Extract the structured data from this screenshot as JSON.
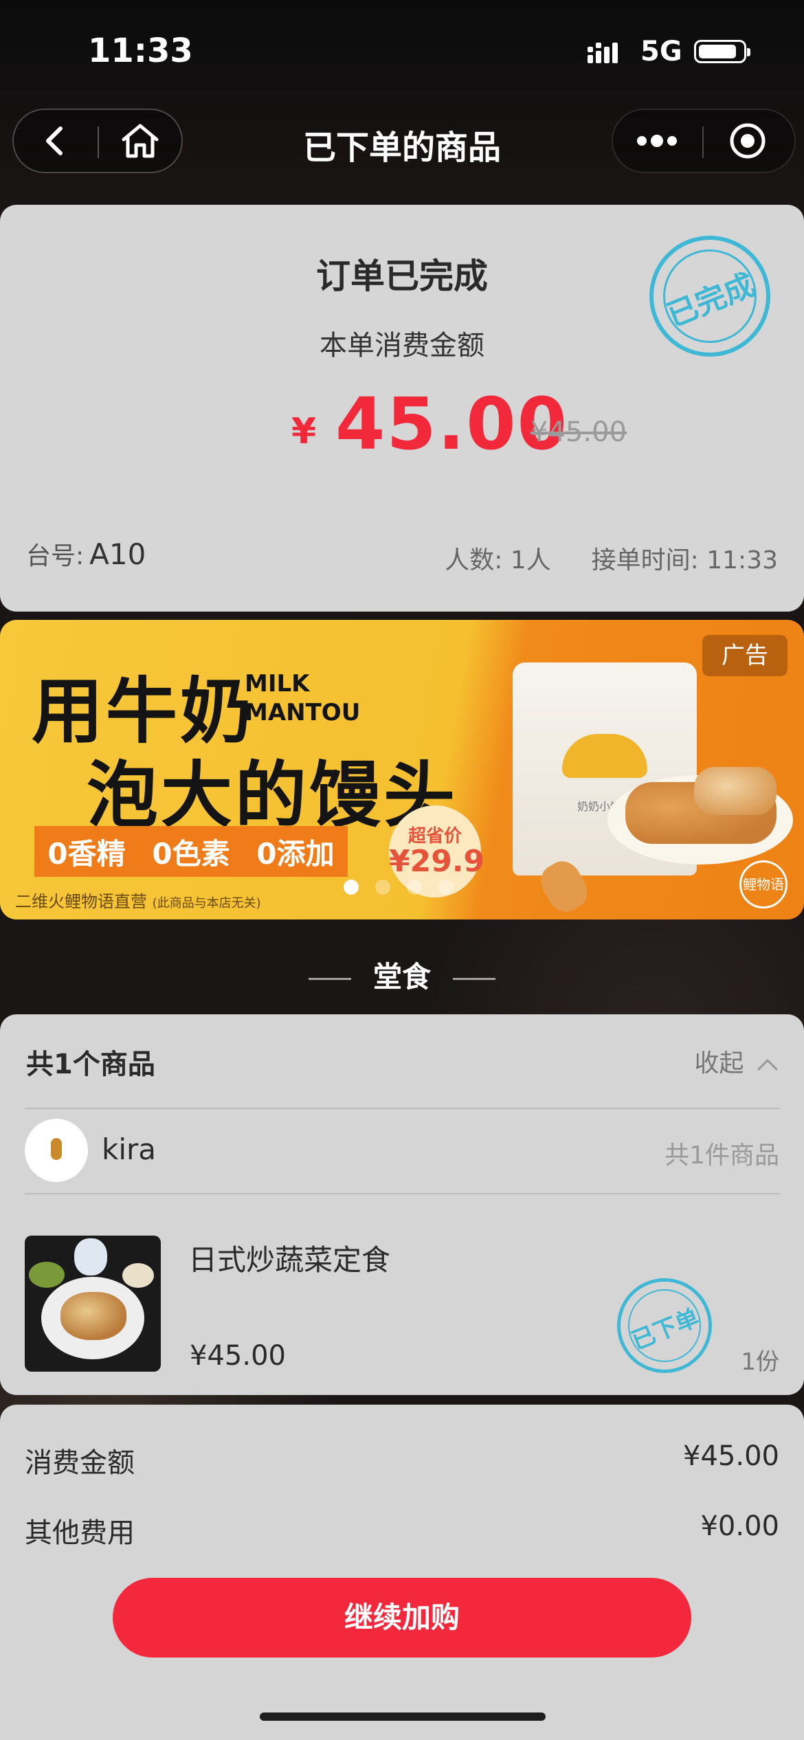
{
  "status_bar": {
    "time": "11:33",
    "network": "5G"
  },
  "nav": {
    "title": "已下单的商品"
  },
  "order": {
    "status_title": "订单已完成",
    "amount_label": "本单消费金额",
    "currency": "¥",
    "amount": "45.00",
    "original_amount": "¥45.00",
    "stamp": "已完成",
    "table_label": "台号:",
    "table_no": "A10",
    "people": "人数: 1人",
    "accept_time": "接单时间: 11:33"
  },
  "banner": {
    "headline1": "用牛奶",
    "headline2": "泡大的馒头",
    "milk_line1": "MILK",
    "milk_line2": "MANTOU",
    "tags": [
      "0香精",
      "0色素",
      "0添加"
    ],
    "price_label": "超省价",
    "price": "¥29.9",
    "ad_label": "广告",
    "seller": "二维火鲤物语直营",
    "disclaimer": "(此商品与本店无关)",
    "bag_label": "奶奶小馒头",
    "logo": "鲤物语",
    "dot_count": 4,
    "active_dot": 0
  },
  "section": {
    "title": "堂食"
  },
  "goods": {
    "count_label": "共1个商品",
    "collapse_label": "收起",
    "shop_name": "kira",
    "shop_count": "共1件商品",
    "item": {
      "name": "日式炒蔬菜定食",
      "price": "¥45.00",
      "qty": "1份",
      "stamp": "已下单"
    }
  },
  "summary": {
    "rows": [
      {
        "label": "消费金额",
        "value": "¥45.00"
      },
      {
        "label": "其他费用",
        "value": "¥0.00"
      }
    ],
    "cta_label": "继续加购"
  },
  "colors": {
    "accent_red": "#f3283c",
    "stamp_blue": "#3fb8d6",
    "banner_yellow": "#f6c83a",
    "banner_orange": "#ef7c19"
  }
}
